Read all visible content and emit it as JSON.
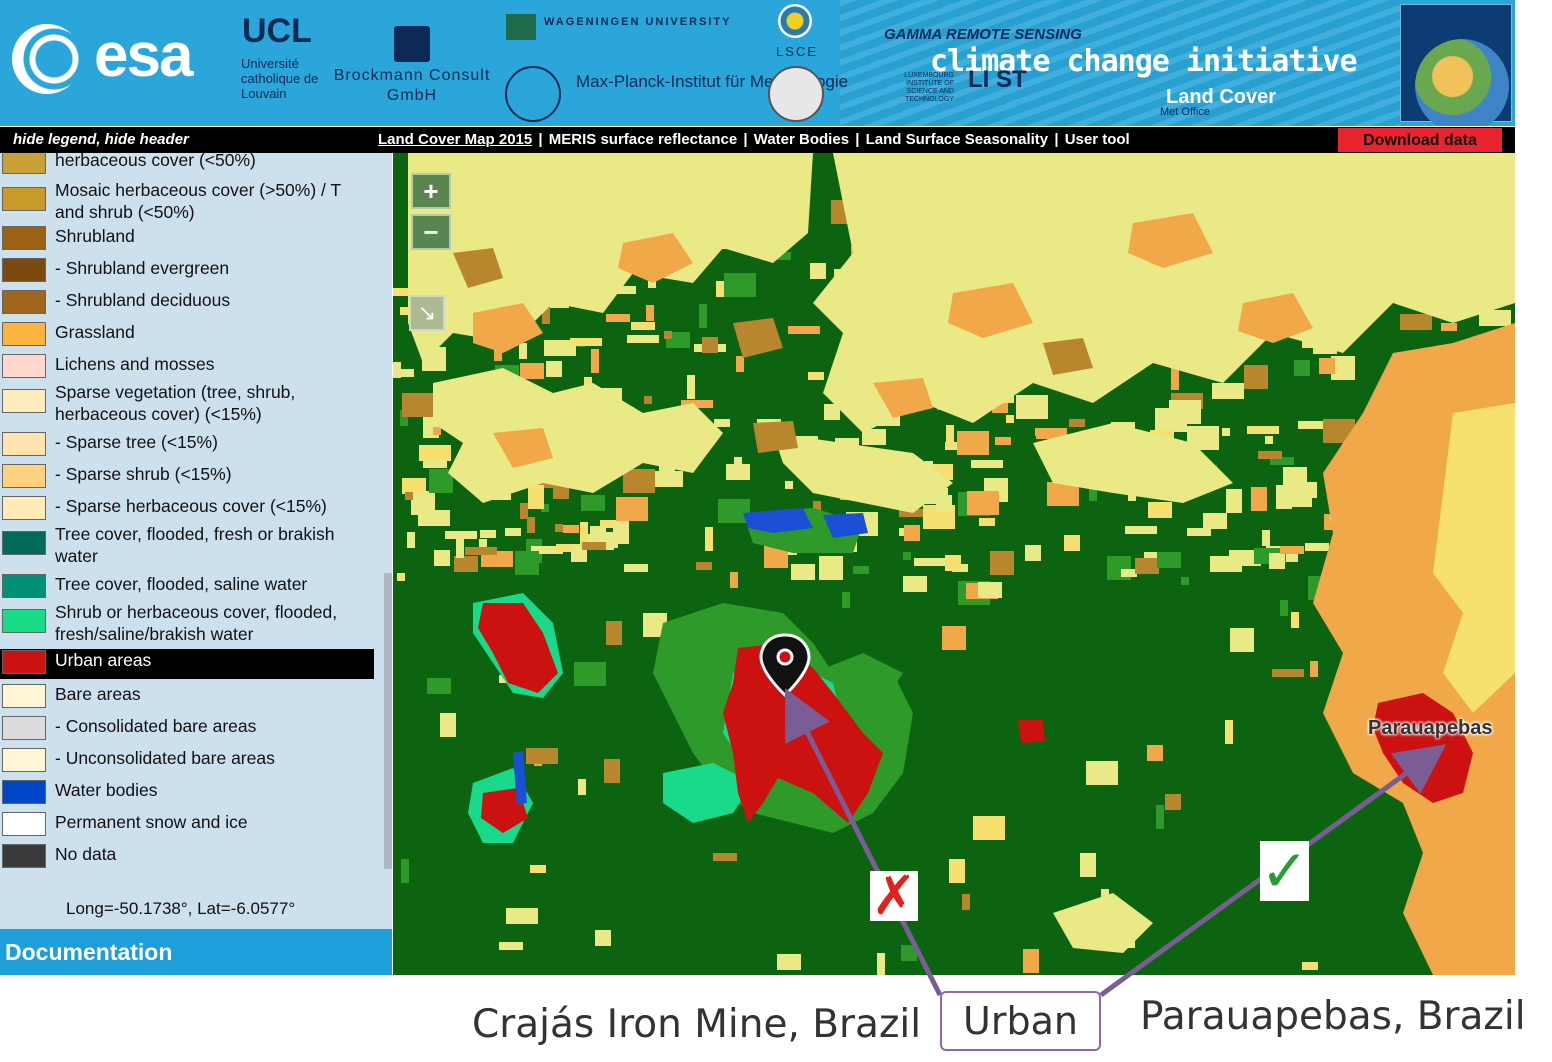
{
  "header": {
    "esa": "esa",
    "ucl": "UCL",
    "ucl_sub": "Université catholique de Louvain",
    "brockmann": "Brockmann Consult GmbH",
    "wageningen": "WAGENINGEN UNIVERSITY",
    "mpi": "Max-Planck-Institut für Meteorologie",
    "lsce": "LSCE",
    "gamma": "GAMMA REMOTE SENSING",
    "cci": "climate change initiative",
    "land_cover": "Land Cover",
    "met_office": "Met Office",
    "luxembourg": "LUXEMBOURG INSTITUTE OF SCIENCE AND TECHNOLOGY",
    "list": "LI ST"
  },
  "navbar": {
    "legend_toggle": "hide legend, hide header",
    "links": [
      "Land Cover Map 2015",
      "MERIS surface reflectance",
      "Water Bodies",
      "Land Surface Seasonality",
      "User tool"
    ],
    "separator": "|",
    "download": "Download data"
  },
  "legend": {
    "items": [
      {
        "label": "herbaceous cover (<50%)",
        "color": "#c8a038"
      },
      {
        "label": "Mosaic herbaceous cover (>50%) / T and shrub (<50%)",
        "color": "#c89a2a"
      },
      {
        "label": "Shrubland",
        "color": "#9c6412"
      },
      {
        "label": "- Shrubland evergreen",
        "color": "#7a4a0f"
      },
      {
        "label": "- Shrubland deciduous",
        "color": "#a0661d"
      },
      {
        "label": "Grassland",
        "color": "#fbb440"
      },
      {
        "label": "Lichens and mosses",
        "color": "#fdd7cc"
      },
      {
        "label": "Sparse vegetation (tree, shrub, herbaceous cover) (<15%)",
        "color": "#ffecbe"
      },
      {
        "label": "- Sparse tree (<15%)",
        "color": "#ffe3b0"
      },
      {
        "label": "- Sparse shrub (<15%)",
        "color": "#ffd27f"
      },
      {
        "label": "- Sparse herbaceous cover (<15%)",
        "color": "#ffebb8"
      },
      {
        "label": "Tree cover, flooded, fresh or brakish water",
        "color": "#006a58"
      },
      {
        "label": "Tree cover, flooded, saline water",
        "color": "#009076"
      },
      {
        "label": "Shrub or herbaceous cover, flooded, fresh/saline/brakish water",
        "color": "#19dd86"
      },
      {
        "label": "Urban areas",
        "color": "#cc1111"
      },
      {
        "label": "Bare areas",
        "color": "#fff5d7"
      },
      {
        "label": "- Consolidated bare areas",
        "color": "#dcdcdc"
      },
      {
        "label": "- Unconsolidated bare areas",
        "color": "#fff5d7"
      },
      {
        "label": "Water bodies",
        "color": "#0046c8"
      },
      {
        "label": "Permanent snow and ice",
        "color": "#ffffff"
      },
      {
        "label": "No data",
        "color": "#3a3a3a"
      }
    ],
    "selected": "Urban areas",
    "coords": "Long=-50.1738°, Lat=-6.0577°",
    "documentation": "Documentation"
  },
  "map": {
    "zoom_in": "+",
    "zoom_out": "−",
    "rotate": "↘",
    "place_label": "Parauapebas",
    "marker_icon": "map-pin-icon"
  },
  "annotations": {
    "left_caption": "Crajás Iron Mine, Brazil",
    "right_caption": "Parauapebas, Brazil",
    "urban_label": "Urban",
    "cross": "✗",
    "check": "✓",
    "arrow_color": "#7b5d96"
  }
}
